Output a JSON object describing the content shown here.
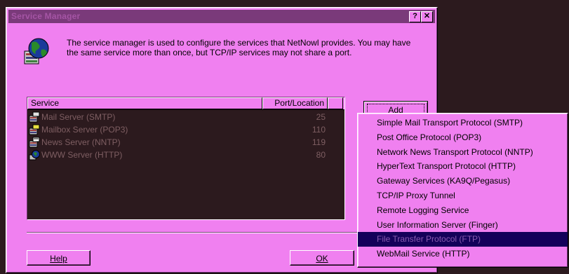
{
  "window": {
    "title": "Service Manager",
    "help_label": "?",
    "close_label": "✕",
    "description": "The service manager is used to configure the services that NetNowl provides.  You may have the same service more than once, but TCP/IP services may not share a port."
  },
  "listview": {
    "columns": {
      "service": "Service",
      "port": "Port/Location"
    },
    "rows": [
      {
        "name": "Mail Server (SMTP)",
        "port": "25",
        "icon": "mail-server-icon"
      },
      {
        "name": "Mailbox Server (POP3)",
        "port": "110",
        "icon": "mailbox-server-icon"
      },
      {
        "name": "News Server (NNTP)",
        "port": "119",
        "icon": "news-server-icon"
      },
      {
        "name": "WWW Server (HTTP)",
        "port": "80",
        "icon": "www-server-icon"
      }
    ]
  },
  "buttons": {
    "add_label": "Add",
    "help_label": "Help",
    "ok_label": "OK"
  },
  "add_menu": {
    "items": [
      "Simple Mail Transport Protocol (SMTP)",
      "Post Office Protocol (POP3)",
      "Network News Transport Protocol (NNTP)",
      "HyperText Transport Protocol (HTTP)",
      "Gateway Services (KA9Q/Pegasus)",
      "TCP/IP Proxy Tunnel",
      "Remote Logging Service",
      "User Information Server (Finger)",
      "File Transfer Protocol (FTP)",
      "WebMail Service (HTTP)"
    ],
    "highlighted_index": 8
  },
  "colors": {
    "dialog_bg": "#f080f0",
    "desktop_bg": "#2c1a1e",
    "titlebar": "#7a3a7a",
    "menu_highlight": "#14005a"
  }
}
